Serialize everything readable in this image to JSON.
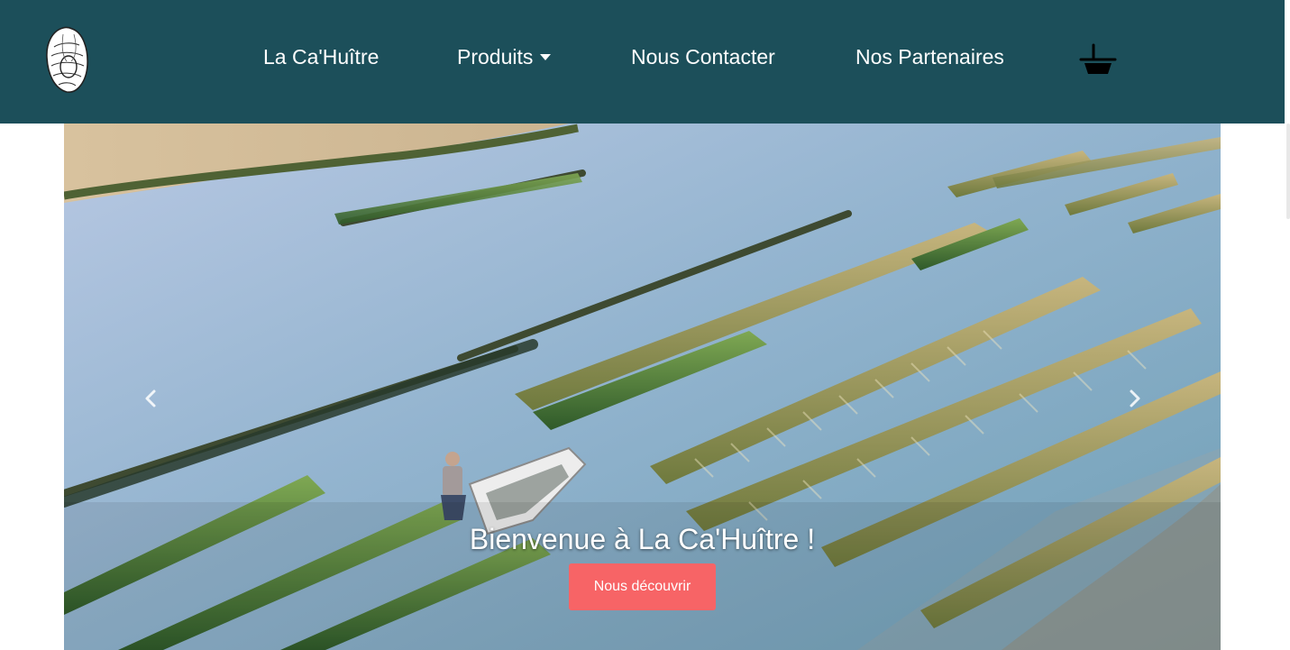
{
  "brand": {
    "logo_icon": "oyster-icon"
  },
  "nav": {
    "items": [
      {
        "label": "La Ca'Huître"
      },
      {
        "label": "Produits",
        "has_dropdown": true
      },
      {
        "label": "Nous Contacter"
      },
      {
        "label": "Nos Partenaires"
      }
    ],
    "cart_icon": "basket-icon"
  },
  "hero": {
    "title": "Bienvenue à La Ca'Huître !",
    "button_label": "Nous découvrir",
    "prev_icon": "chevron-left-icon",
    "next_icon": "chevron-right-icon",
    "image_subject": "oyster-farm-aerial-photo"
  },
  "colors": {
    "navbar_bg": "#1c4f5a",
    "nav_text": "#ffffff",
    "cta_bg": "#f76466",
    "cta_text": "#ffffff"
  }
}
